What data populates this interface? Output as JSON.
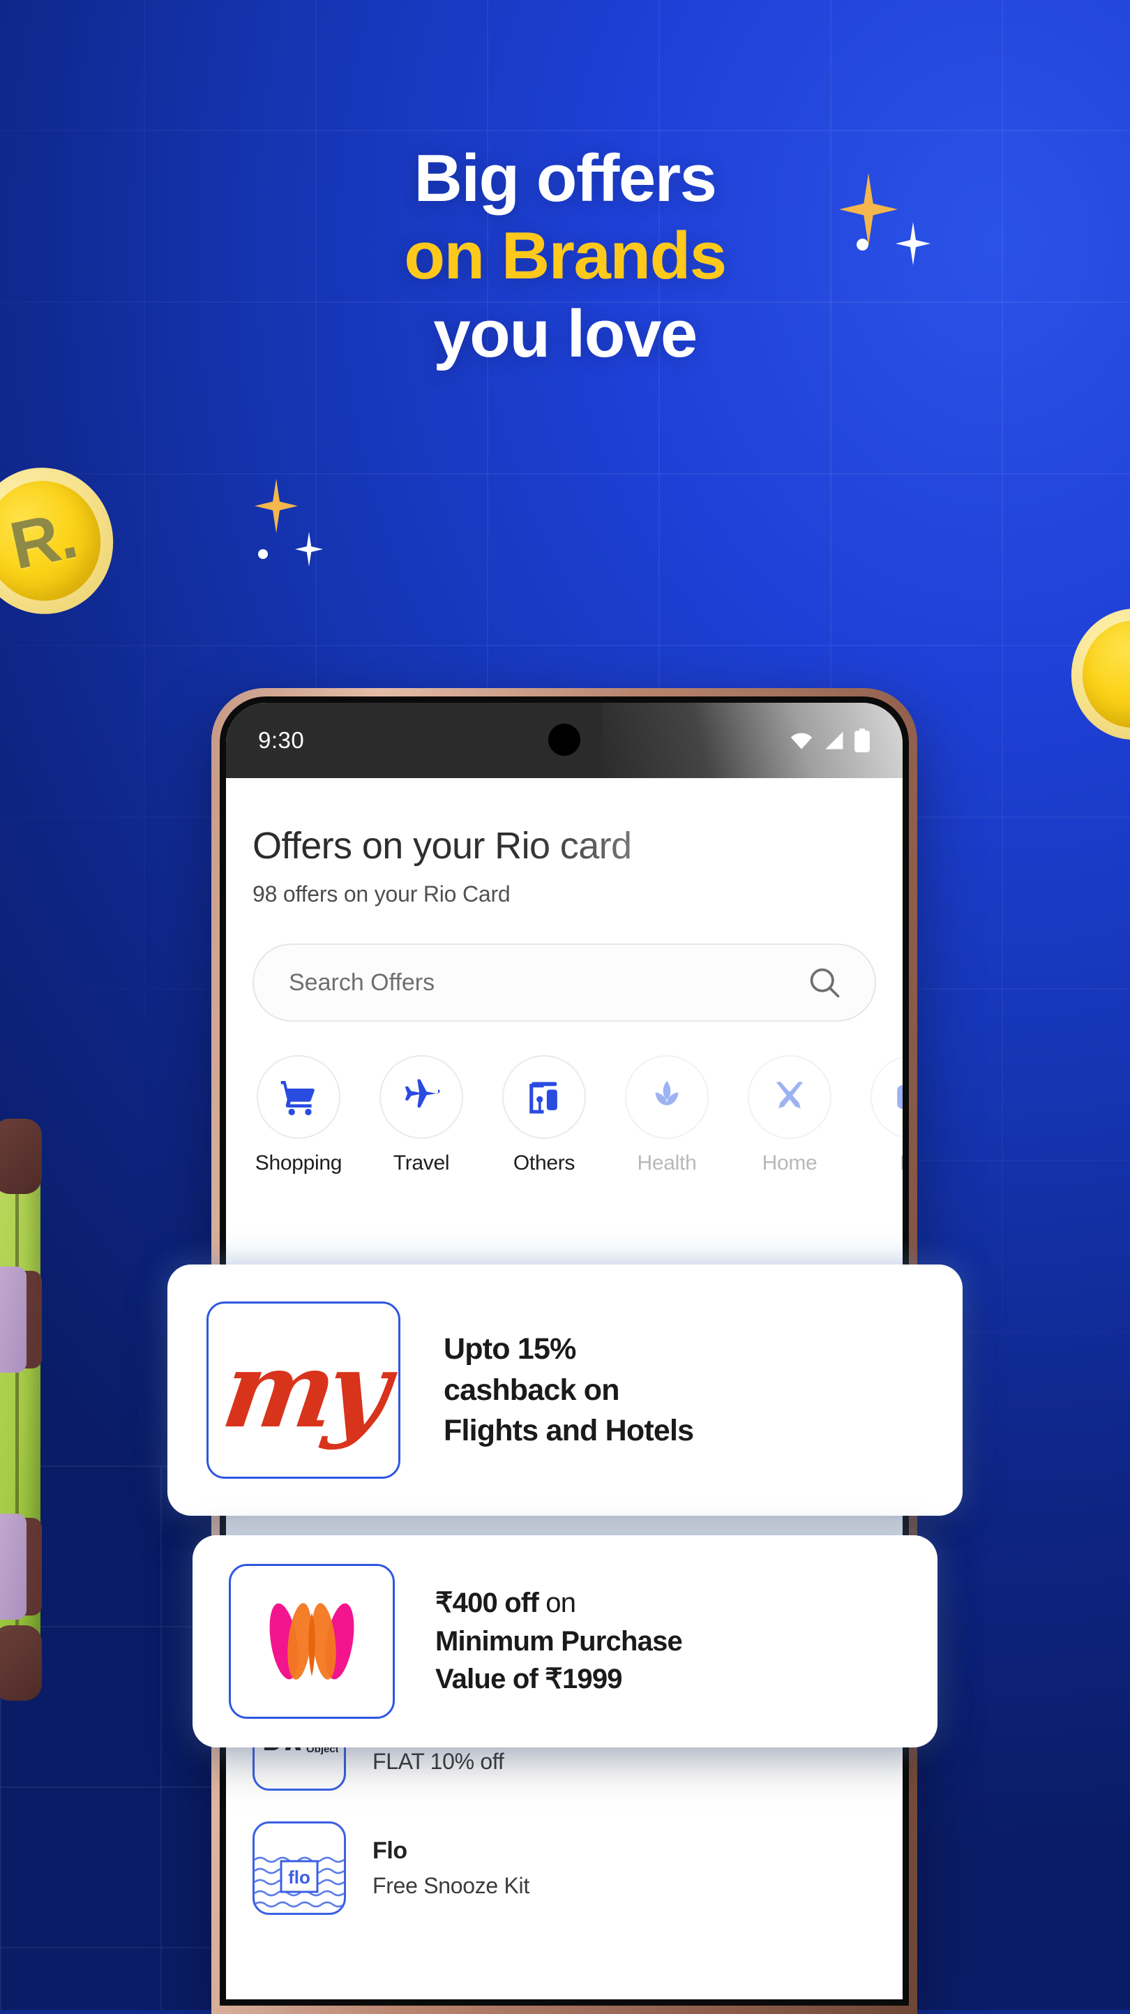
{
  "hero": {
    "line1": "Big offers",
    "line2": "on Brands",
    "line3": "you love",
    "accent_color": "#FFC91C",
    "bg_color": "#1535B4"
  },
  "decorations": {
    "coin_left_label": "R.",
    "coin_right_label": "",
    "luggage": "green-suitcase",
    "sparkles": 6
  },
  "phone": {
    "status_bar": {
      "time": "9:30",
      "icons": [
        "wifi-icon",
        "signal-icon",
        "battery-icon"
      ]
    },
    "app": {
      "title": "Offers on your Rio card",
      "subtitle": "98 offers on your Rio Card",
      "search": {
        "placeholder": "Search Offers",
        "icon": "search-icon"
      },
      "categories": [
        {
          "label": "Shopping",
          "icon": "cart-icon",
          "active": true
        },
        {
          "label": "Travel",
          "icon": "plane-icon",
          "active": true
        },
        {
          "label": "Others",
          "icon": "bag-icon",
          "active": true
        },
        {
          "label": "Health",
          "icon": "leaf-icon",
          "active": false
        },
        {
          "label": "Home",
          "icon": "tools-icon",
          "active": false
        },
        {
          "label": "En",
          "icon": "other-icon",
          "active": false
        }
      ],
      "list_rows": [
        {
          "brand": "Daily Objects",
          "offer": "FLAT 10% off",
          "logo": "dailyobjects-logo"
        },
        {
          "brand": "Flo",
          "offer": "Free Snooze Kit",
          "logo": "flo-logo"
        }
      ]
    }
  },
  "offer_cards": [
    {
      "logo": "makemytrip-logo",
      "logo_text": "my",
      "line1": "Upto 15%",
      "line2": "cashback on",
      "line3": "Flights and Hotels"
    },
    {
      "logo": "myntra-logo",
      "line1_bold": "₹400 off",
      "line1_rest": " on",
      "line2": "Minimum Purchase",
      "line3": "Value of ₹1999"
    }
  ]
}
